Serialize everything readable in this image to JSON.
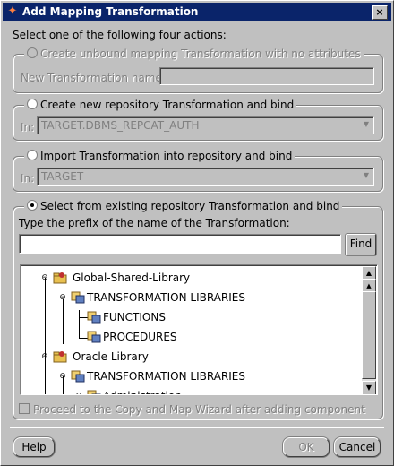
{
  "window": {
    "title": "Add Mapping Transformation",
    "close_glyph": "×"
  },
  "instruction": "Select one of the following four actions:",
  "options": {
    "unbound": {
      "label": "Create unbound mapping Transformation with no attributes",
      "name_label": "New Transformation name:",
      "name_value": ""
    },
    "new_repo": {
      "label": "Create new repository Transformation and bind",
      "in_label": "In:",
      "in_value": "TARGET.DBMS_REPCAT_AUTH"
    },
    "import": {
      "label": "Import Transformation into repository and bind",
      "in_label": "In:",
      "in_value": "TARGET"
    },
    "existing": {
      "label": "Select from existing repository Transformation and bind",
      "prefix_label": "Type the prefix of the name of the Transformation:",
      "prefix_value": "",
      "find_label": "Find"
    }
  },
  "tree": {
    "nodes": [
      {
        "label": "Global-Shared-Library",
        "icon": "library-folder-icon"
      },
      {
        "label": "TRANSFORMATION LIBRARIES",
        "icon": "transformation-icon"
      },
      {
        "label": "FUNCTIONS",
        "icon": "functions-icon"
      },
      {
        "label": "PROCEDURES",
        "icon": "procedures-icon"
      },
      {
        "label": "Oracle Library",
        "icon": "library-folder-icon"
      },
      {
        "label": "TRANSFORMATION LIBRARIES",
        "icon": "transformation-icon"
      },
      {
        "label": "Administration",
        "icon": "transformation-icon"
      }
    ]
  },
  "proceed_checkbox": {
    "label": "Proceed to the Copy and Map Wizard after adding component",
    "checked": false
  },
  "buttons": {
    "help": "Help",
    "ok": "OK",
    "cancel": "Cancel"
  },
  "colors": {
    "titlebar": "#0a246a",
    "face": "#c0c0c0"
  }
}
